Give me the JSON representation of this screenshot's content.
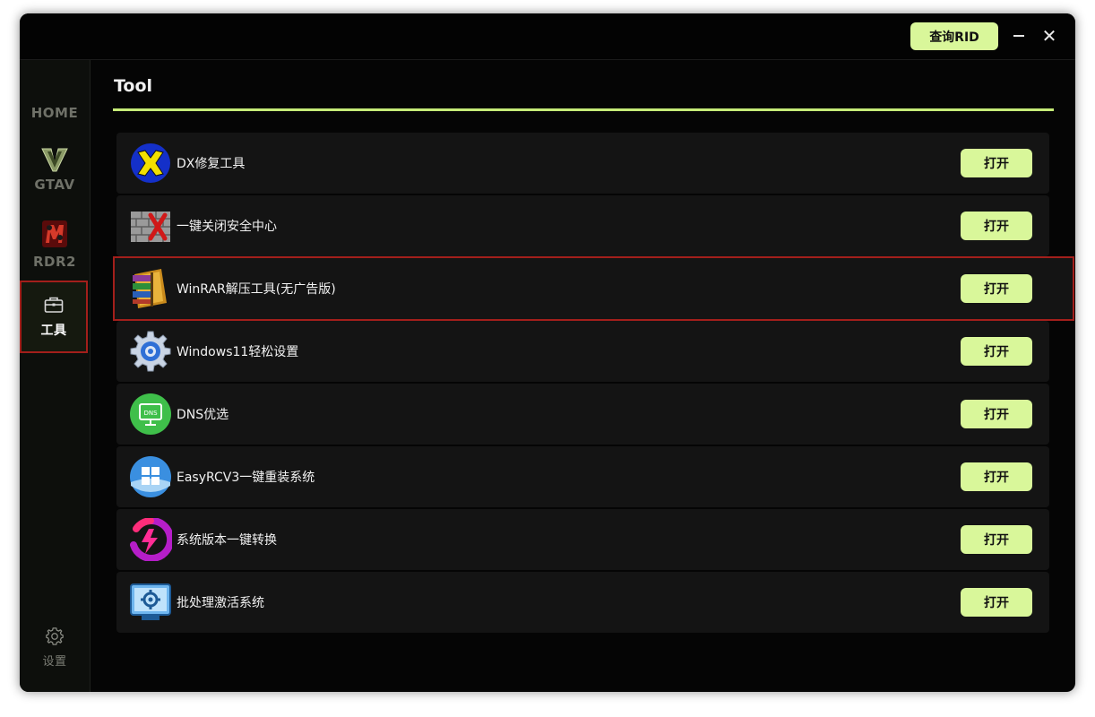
{
  "titlebar": {
    "rid_button_label": "查询RID",
    "close_glyph": "✕"
  },
  "sidebar": {
    "home_label": "HOME",
    "gtav_label": "GTAV",
    "rdr2_label": "RDR2",
    "tools_label": "工具",
    "settings_label": "设置"
  },
  "main": {
    "title": "Tool",
    "accent_color": "#c6ec78",
    "tools": [
      {
        "name": "DX修复工具",
        "button": "打开",
        "icon": "dx-repair-icon"
      },
      {
        "name": "一键关闭安全中心",
        "button": "打开",
        "icon": "firewall-icon"
      },
      {
        "name": "WinRAR解压工具(无广告版)",
        "button": "打开",
        "icon": "winrar-icon"
      },
      {
        "name": "Windows11轻松设置",
        "button": "打开",
        "icon": "gear-settings-icon"
      },
      {
        "name": "DNS优选",
        "button": "打开",
        "icon": "dns-monitor-icon"
      },
      {
        "name": "EasyRCV3一键重装系统",
        "button": "打开",
        "icon": "windows-logo-icon"
      },
      {
        "name": "系统版本一键转换",
        "button": "打开",
        "icon": "lightning-swirl-icon"
      },
      {
        "name": "批处理激活系统",
        "button": "打开",
        "icon": "monitor-gear-icon"
      }
    ]
  }
}
